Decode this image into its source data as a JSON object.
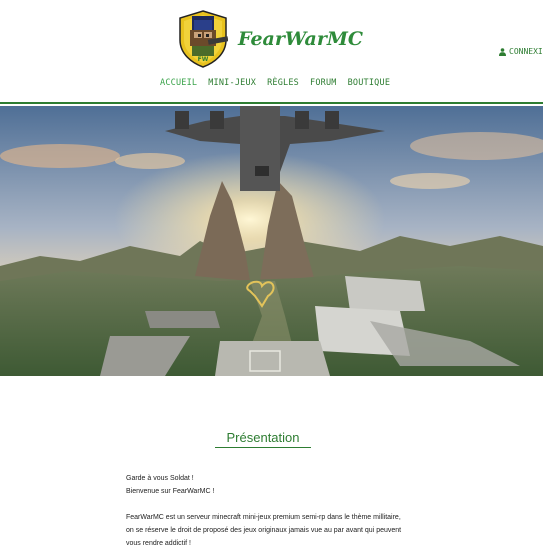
{
  "brand": {
    "name": "FearWarMC",
    "badge": "FW"
  },
  "header": {
    "login_label": "CONNEXIO"
  },
  "nav": {
    "items": [
      {
        "label": "ACCUEIL",
        "active": true
      },
      {
        "label": "MINI-JEUX",
        "active": false
      },
      {
        "label": "RÈGLES",
        "active": false
      },
      {
        "label": "FORUM",
        "active": false
      },
      {
        "label": "BOUTIQUE",
        "active": false
      }
    ]
  },
  "presentation": {
    "title": "Présentation",
    "greeting1": "Garde à vous Soldat !",
    "greeting2": "Bienvenue sur FearWarMC !",
    "desc1": "FearWarMC est un serveur minecraft mini-jeux premium semi-rp dans le thème millitaire,",
    "desc2": "on se réserve le droit de proposé des jeux originaux jamais vue au par avant qui peuvent",
    "desc3": "vous rendre addictif !"
  },
  "colors": {
    "accent": "#2e7d32",
    "brand": "#2e8b3a"
  }
}
